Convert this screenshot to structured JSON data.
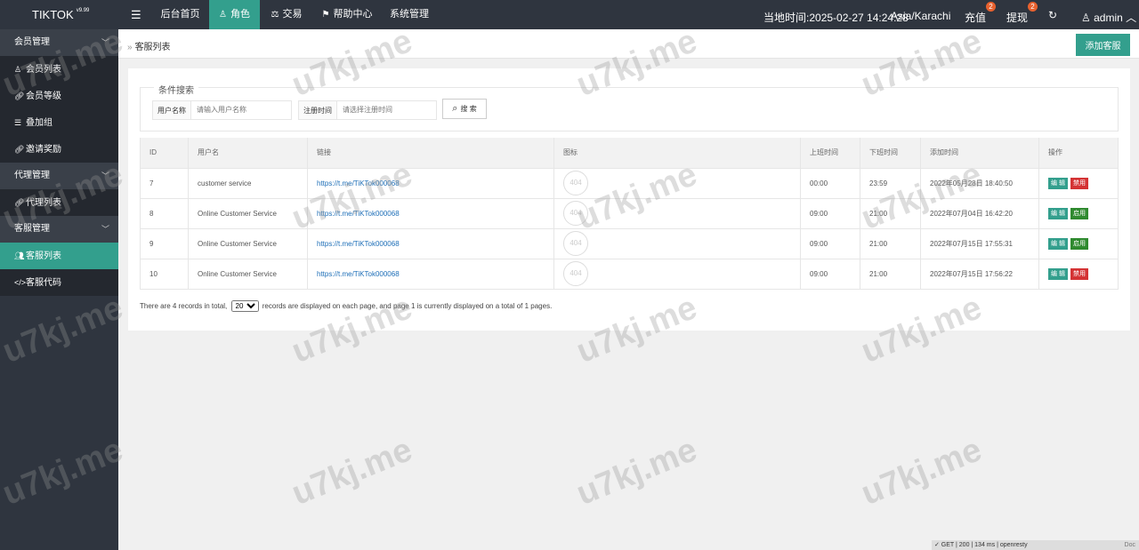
{
  "app": {
    "name": "TIKTOK",
    "version": "v9.99"
  },
  "top_nav": [
    {
      "label": "后台首页",
      "icon": "",
      "active": false
    },
    {
      "label": "角色",
      "icon": "user-icon",
      "active": true
    },
    {
      "label": "交易",
      "icon": "scale-icon",
      "active": false
    },
    {
      "label": "帮助中心",
      "icon": "flag-icon",
      "active": false
    },
    {
      "label": "系统管理",
      "icon": "",
      "active": false
    }
  ],
  "top_right": {
    "time_label": "当地时间:",
    "time_value": "2025-02-27 14:24:28",
    "timezone": "Asia/Karachi",
    "recharge": "充值",
    "recharge_badge": "2",
    "withdraw": "提现",
    "withdraw_badge": "2",
    "user": "admin"
  },
  "sidebar": [
    {
      "label": "会员管理",
      "type": "group",
      "icon": ""
    },
    {
      "label": "会员列表",
      "type": "sub",
      "icon": "user-icon"
    },
    {
      "label": "会员等级",
      "type": "sub",
      "icon": "link-icon"
    },
    {
      "label": "叠加组",
      "type": "sub",
      "icon": "list-icon"
    },
    {
      "label": "邀请奖励",
      "type": "sub",
      "icon": "link-icon"
    },
    {
      "label": "代理管理",
      "type": "group",
      "icon": ""
    },
    {
      "label": "代理列表",
      "type": "sub",
      "icon": "link-icon"
    },
    {
      "label": "客服管理",
      "type": "group",
      "icon": ""
    },
    {
      "label": "客服列表",
      "type": "active",
      "icon": "users-icon"
    },
    {
      "label": "客服代码",
      "type": "sub",
      "icon": "code-icon"
    }
  ],
  "page": {
    "breadcrumb": "客服列表",
    "add_button": "添加客服"
  },
  "search": {
    "legend": "条件搜索",
    "username_label": "用户名称",
    "username_placeholder": "请输入用户名称",
    "regtime_label": "注册时间",
    "regtime_placeholder": "请选择注册时间",
    "button": "搜 索"
  },
  "table": {
    "headers": [
      "ID",
      "用户名",
      "链接",
      "图标",
      "上班时间",
      "下班时间",
      "添加时间",
      "操作"
    ],
    "rows": [
      {
        "id": "7",
        "username": "customer service",
        "link": "https://t.me/TiKTok000068",
        "icon": "404",
        "start": "00:00",
        "end": "23:59",
        "added": "2022年05月28日 18:40:50",
        "edit": "编 辑",
        "toggle": "禁用",
        "toggle_type": "disable"
      },
      {
        "id": "8",
        "username": "Online Customer Service",
        "link": "https://t.me/TiKTok000068",
        "icon": "404",
        "start": "09:00",
        "end": "21:00",
        "added": "2022年07月04日 16:42:20",
        "edit": "编 辑",
        "toggle": "启用",
        "toggle_type": "enable"
      },
      {
        "id": "9",
        "username": "Online Customer Service",
        "link": "https://t.me/TiKTok000068",
        "icon": "404",
        "start": "09:00",
        "end": "21:00",
        "added": "2022年07月15日 17:55:31",
        "edit": "编 辑",
        "toggle": "启用",
        "toggle_type": "enable"
      },
      {
        "id": "10",
        "username": "Online Customer Service",
        "link": "https://t.me/TiKTok000068",
        "icon": "404",
        "start": "09:00",
        "end": "21:00",
        "added": "2022年07月15日 17:56:22",
        "edit": "编 辑",
        "toggle": "禁用",
        "toggle_type": "disable"
      }
    ]
  },
  "pagination": {
    "text_before": "There are 4 records in total,",
    "page_size": "20",
    "text_after": "records are displayed on each page, and page 1 is currently displayed on a total of 1 pages."
  },
  "status_bar": {
    "text": "✓ GET | 200 | 134 ms | openresty",
    "doc": "Doc"
  },
  "watermark": "u7kj.me",
  "colors": {
    "accent": "#339f8d",
    "sidebar": "#2f353f",
    "danger": "#d43334",
    "success": "#2f8a2f",
    "badge": "#e8612e",
    "link": "#1e6fb8"
  }
}
